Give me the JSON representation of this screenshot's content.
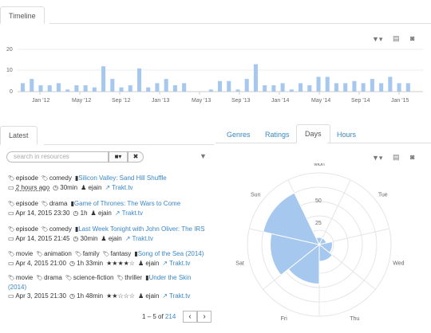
{
  "timeline": {
    "tab_label": "Timeline",
    "y_ticks": [
      "20",
      "10",
      "0"
    ],
    "x_ticks": [
      "Jan '12",
      "May '12",
      "Sep '12",
      "Jan '13",
      "May '13",
      "Sep '13",
      "Jan '14",
      "May '14",
      "Sep '14",
      "Jan '15"
    ]
  },
  "chart_data": [
    {
      "type": "bar",
      "title": "",
      "ylim": [
        0,
        23
      ],
      "values": [
        4,
        6,
        3,
        3,
        4,
        1,
        3,
        3,
        2,
        12,
        6,
        2,
        3,
        11,
        2,
        4,
        6,
        3,
        4,
        0,
        0,
        1,
        5,
        5,
        1,
        6,
        13,
        3,
        3,
        4,
        1,
        4,
        3,
        7,
        7,
        4,
        4,
        5,
        4,
        6,
        4,
        7,
        4,
        4
      ],
      "x_tick_labels": [
        "Jan '12",
        "May '12",
        "Sep '12",
        "Jan '13",
        "May '13",
        "Sep '13",
        "Jan '14",
        "May '14",
        "Sep '14",
        "Jan '15"
      ]
    },
    {
      "type": "polar-area",
      "categories": [
        "Mon",
        "Tue",
        "Wed",
        "Thu",
        "Fri",
        "Sat",
        "Sun"
      ],
      "values": [
        6,
        6,
        11,
        14,
        33,
        41,
        48
      ],
      "radial_ticks": [
        "25",
        "50"
      ],
      "rmax": 60
    }
  ],
  "latest": {
    "tab_label": "Latest",
    "search_placeholder": "search in resources",
    "items": [
      {
        "tags": [
          "episode",
          "comedy"
        ],
        "title": "Silicon Valley: Sand Hill Shuffle",
        "date": "2 hours ago",
        "duration": "30min",
        "rating": "",
        "user": "ejain",
        "link": "Trakt.tv"
      },
      {
        "tags": [
          "episode",
          "drama"
        ],
        "title": "Game of Thrones: The Wars to Come",
        "date": "Apr 14, 2015 23:30",
        "duration": "1h",
        "rating": "",
        "user": "ejain",
        "link": "Trakt.tv"
      },
      {
        "tags": [
          "episode",
          "comedy"
        ],
        "title": "Last Week Tonight with John Oliver: The IRS",
        "date": "Apr 14, 2015 21:45",
        "duration": "30min",
        "rating": "",
        "user": "ejain",
        "link": "Trakt.tv"
      },
      {
        "tags": [
          "movie",
          "animation",
          "family",
          "fantasy"
        ],
        "title": "Song of the Sea (2014)",
        "date": "Apr 4, 2015 21:00",
        "duration": "1h 33min",
        "rating": "★★★★☆",
        "user": "ejain",
        "link": "Trakt.tv"
      },
      {
        "tags": [
          "movie",
          "drama",
          "science-fiction",
          "thriller"
        ],
        "title": "Under the Skin (2014)",
        "date": "Apr 3, 2015 21:30",
        "duration": "1h 48min",
        "rating": "★★☆☆☆",
        "user": "ejain",
        "link": "Trakt.tv"
      }
    ],
    "pager_prefix": "1 – 5 of",
    "pager_total": "214"
  },
  "stats": {
    "tabs": [
      "Genres",
      "Ratings",
      "Days",
      "Hours"
    ],
    "active_tab": "Days"
  },
  "colors": {
    "bar": "#a6c8ee",
    "link": "#3a87c8"
  }
}
